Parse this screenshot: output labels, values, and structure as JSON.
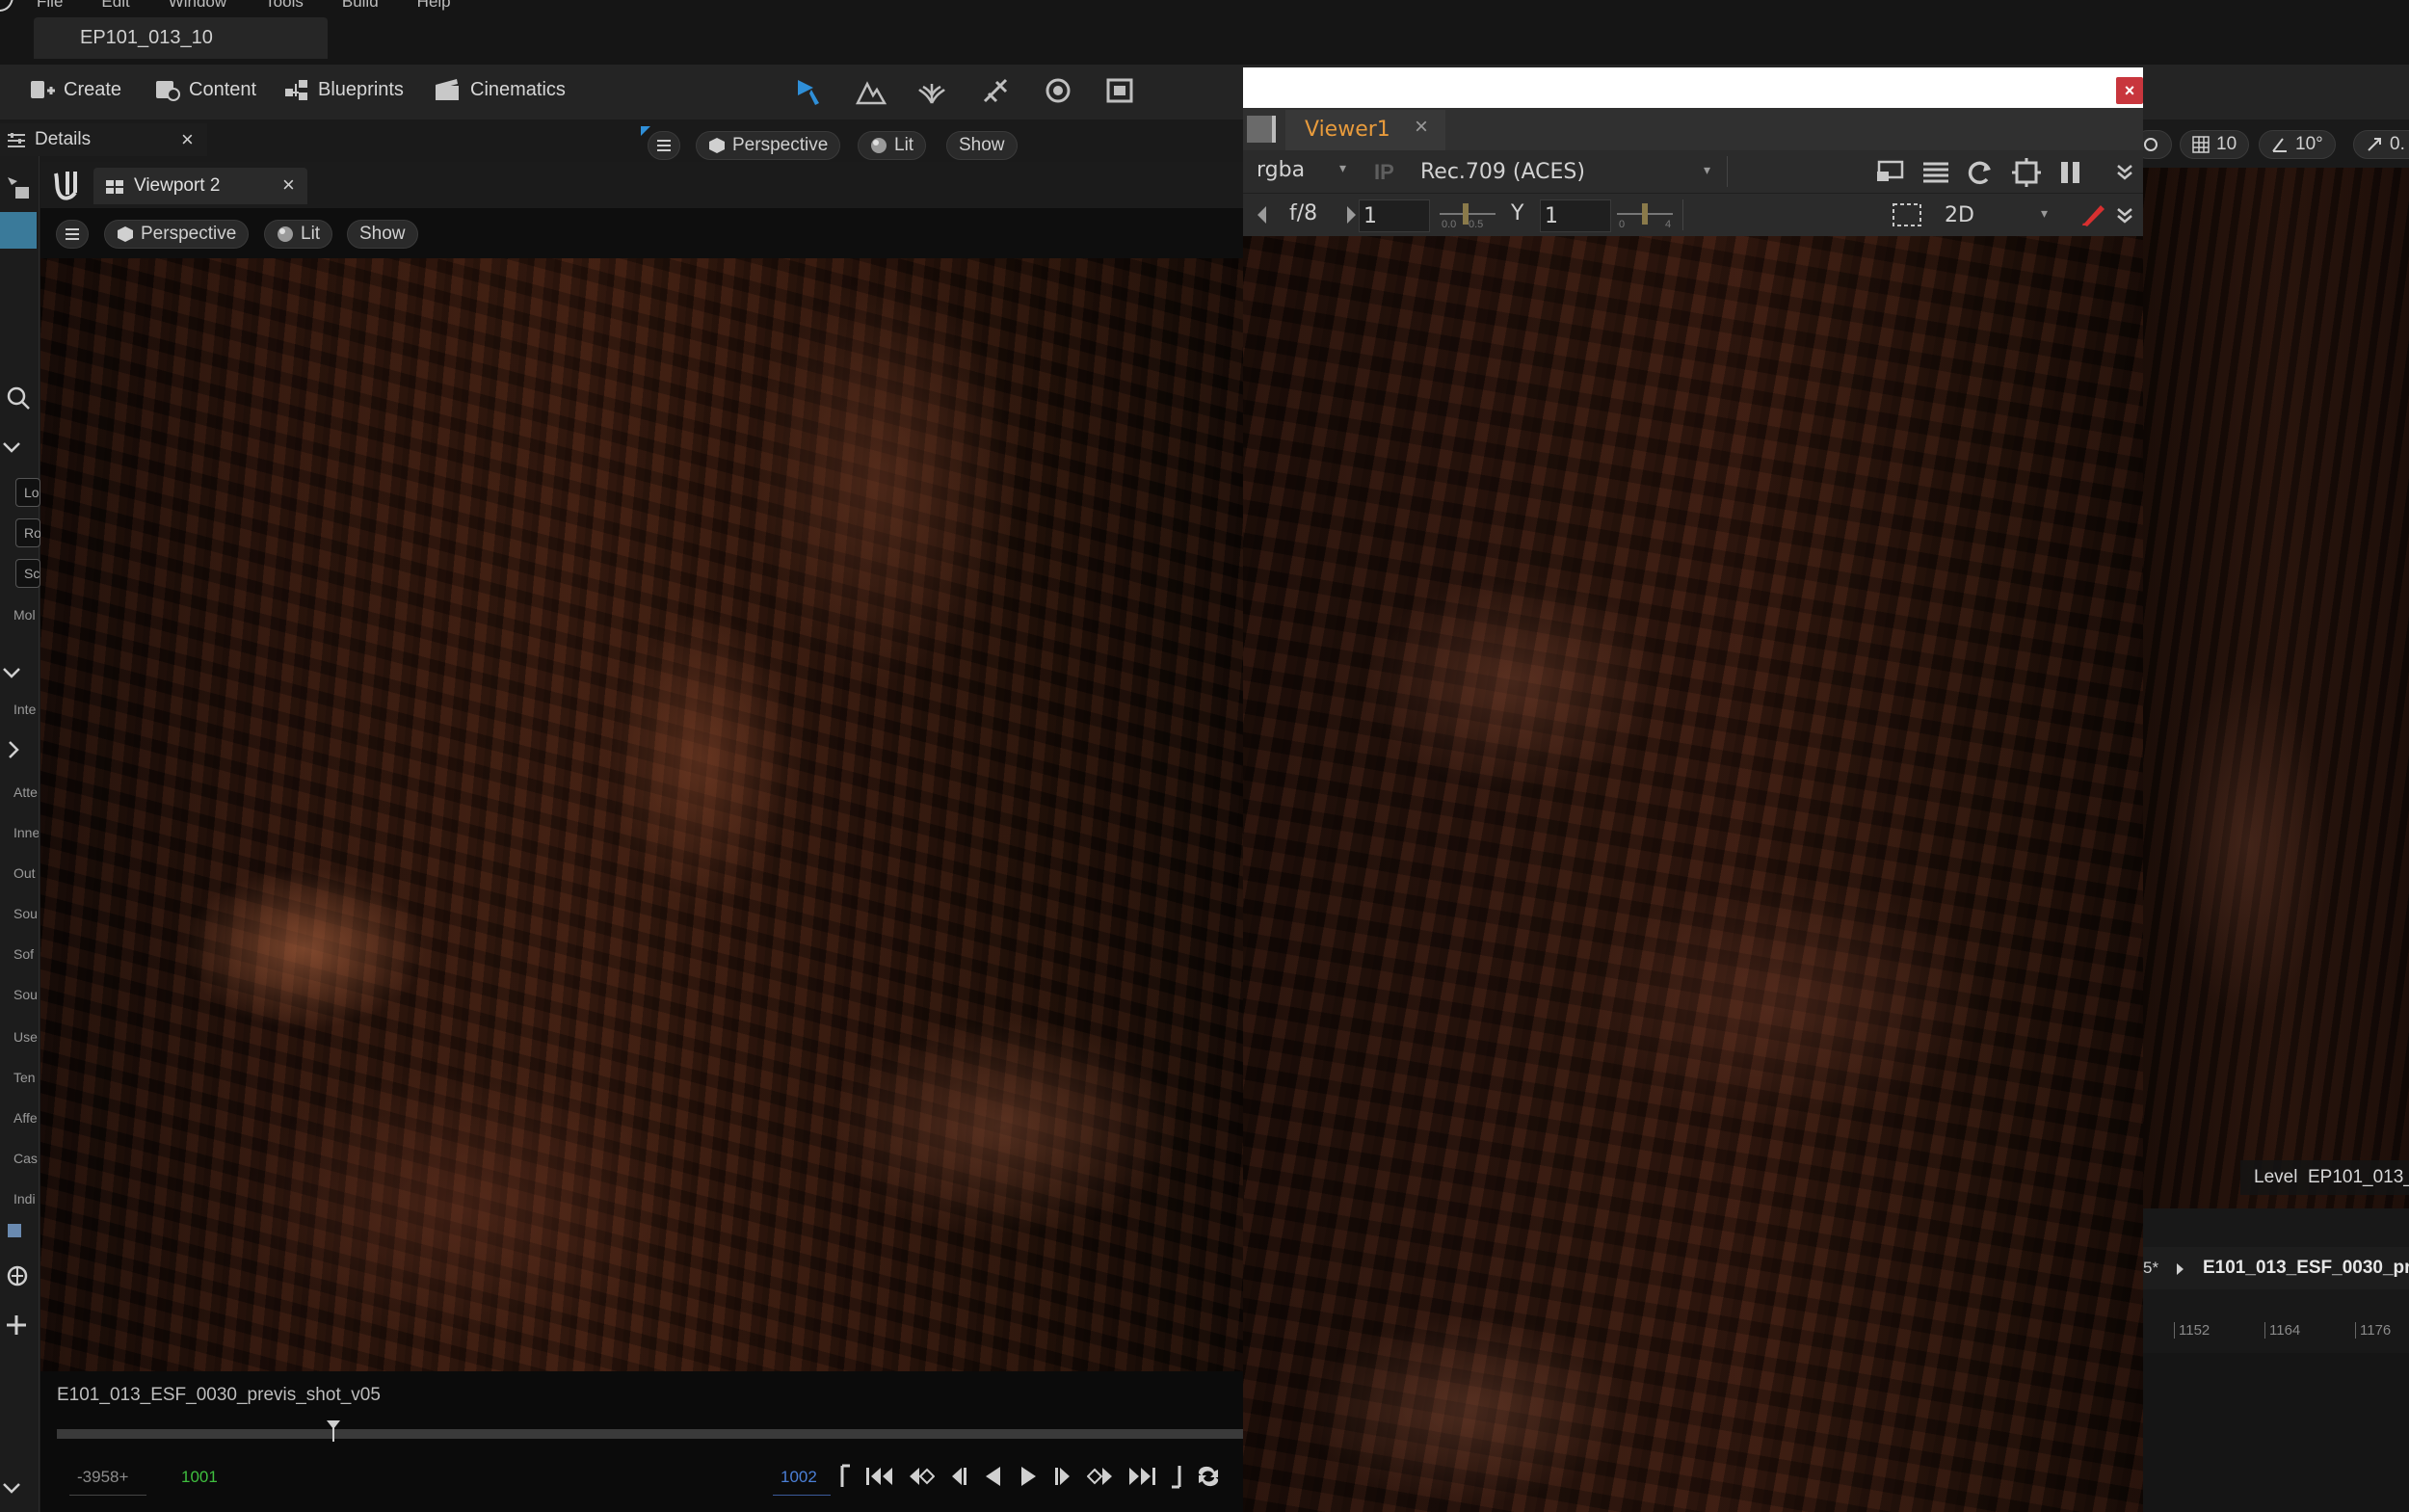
{
  "menu": {
    "items": [
      "File",
      "Edit",
      "Window",
      "Tools",
      "Build",
      "Help"
    ]
  },
  "level_tab": {
    "label": "EP101_013_10"
  },
  "toolbar": {
    "create": "Create",
    "content": "Content",
    "blueprints": "Blueprints",
    "cinematics": "Cinematics"
  },
  "details_panel": {
    "title": "Details"
  },
  "main_viewport": {
    "perspective": "Perspective",
    "lit": "Lit",
    "show": "Show"
  },
  "viewport2": {
    "tab_label": "Viewport 2",
    "perspective": "Perspective",
    "lit": "Lit",
    "show": "Show"
  },
  "sidebar_labels": [
    "Lo",
    "Ro",
    "Sc",
    "Mol",
    "Inte",
    "Atte",
    "Inne",
    "Out",
    "Sou",
    "Sof",
    "Sou",
    "Use",
    "Ten",
    "Affe",
    "Cas",
    "Indi"
  ],
  "sequencer": {
    "shot_name": "E101_013_ESF_0030_previs_shot_v05",
    "start_frame": "-3958+",
    "current_frame": "1001",
    "end_frame": "1002",
    "playhead_fraction": 0.233
  },
  "right_toolbar": {
    "grid": "10",
    "angle": "10°",
    "scale": "0."
  },
  "right_panel": {
    "level_label": "Level  EP101_013_",
    "sequence_label": "E101_013_ESF_0030_pre",
    "sequence_prefix": "5*",
    "ticks": [
      "1152",
      "1164",
      "1176"
    ]
  },
  "nuke_viewer": {
    "tab_label": "Viewer1",
    "channels": "rgba",
    "ip": "IP",
    "colorspace": "Rec.709 (ACES)",
    "fstop": "f/8",
    "gain": "1",
    "gamma_label": "Y",
    "gamma": "1",
    "gain_slider_min": "0.0",
    "gain_slider_max": "0.5",
    "gamma_slider_min": "0",
    "gamma_slider_max": "4",
    "view_mode": "2D"
  },
  "colors": {
    "nuke_accent": "#e89b3c",
    "close_red": "#c8363d",
    "ue_blue": "#2f8fd8",
    "frame_green": "#3fbf3f",
    "frame_blue": "#4b7fd6"
  }
}
